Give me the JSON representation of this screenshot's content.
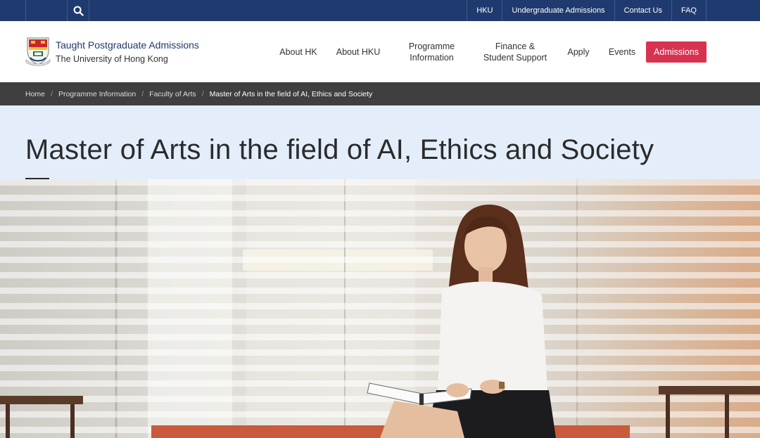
{
  "topbar": {
    "links": [
      "HKU",
      "Undergraduate Admissions",
      "Contact Us",
      "FAQ"
    ]
  },
  "brand": {
    "title": "Taught Postgraduate Admissions",
    "subtitle": "The University of Hong Kong"
  },
  "nav": {
    "items": [
      "About HK",
      "About HKU",
      "Programme\nInformation",
      "Finance &\nStudent Support",
      "Apply",
      "Events"
    ],
    "cta": "Admissions"
  },
  "breadcrumb": [
    "Home",
    "Programme Information",
    "Faculty of Arts",
    "Master of Arts in the field of AI, Ethics and Society"
  ],
  "page": {
    "title": "Master of Arts in the field of AI, Ethics and Society"
  },
  "colors": {
    "topbar": "#1f3a6e",
    "accent": "#d73351",
    "breadcrumb_bg": "#3f3f3f",
    "title_band": "#e3eefa"
  },
  "icons": {
    "search": "search-icon",
    "logo": "university-crest-icon"
  }
}
